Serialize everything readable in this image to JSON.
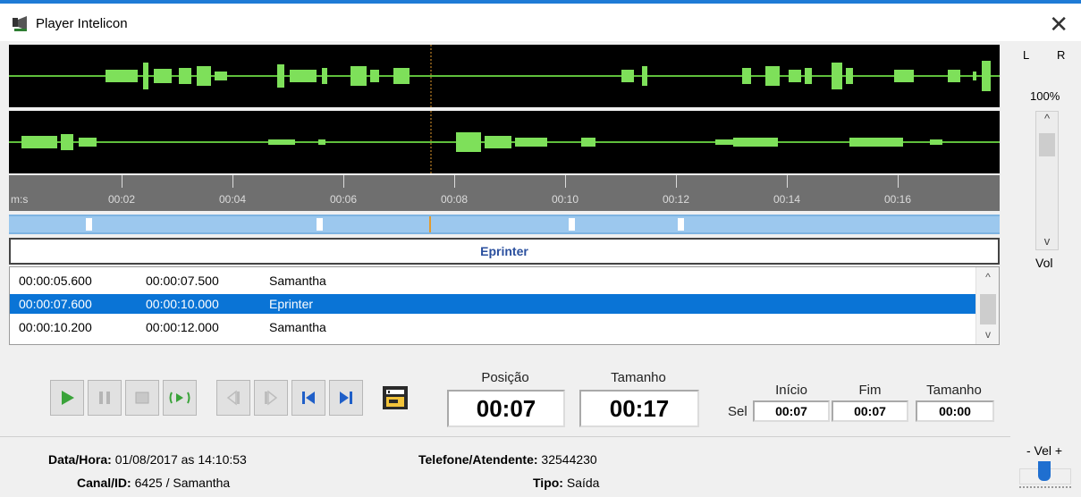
{
  "window": {
    "title": "Player Intelicon",
    "close_icon": "close-icon"
  },
  "timeline": {
    "unit": "m:s",
    "ticks": [
      "00:02",
      "00:04",
      "00:06",
      "00:08",
      "00:10",
      "00:12",
      "00:14",
      "00:16"
    ]
  },
  "segment_title": "Eprinter",
  "segments": [
    {
      "start": "00:00:05.600",
      "end": "00:00:07.500",
      "speaker": "Samantha",
      "selected": false
    },
    {
      "start": "00:00:07.600",
      "end": "00:00:10.000",
      "speaker": "Eprinter",
      "selected": true
    },
    {
      "start": "00:00:10.200",
      "end": "00:00:12.000",
      "speaker": "Samantha",
      "selected": false
    }
  ],
  "transport": {
    "buttons": [
      "play-icon",
      "pause-icon",
      "stop-icon",
      "loop-play-icon",
      "step-back-icon",
      "step-forward-icon",
      "skip-start-icon",
      "skip-end-icon",
      "export-icon"
    ]
  },
  "position": {
    "label": "Posição",
    "value": "00:07"
  },
  "length": {
    "label": "Tamanho",
    "value": "00:17"
  },
  "selection": {
    "prefix": "Sel",
    "start_label": "Início",
    "start_value": "00:07",
    "end_label": "Fim",
    "end_value": "00:07",
    "size_label": "Tamanho",
    "size_value": "00:00"
  },
  "volume": {
    "left_label": "L",
    "right_label": "R",
    "percent": "100%",
    "label": "Vol"
  },
  "speed": {
    "label": "- Vel +"
  },
  "info": {
    "datetime_label": "Data/Hora:",
    "datetime_value": "01/08/2017 as 14:10:53",
    "channel_label": "Canal/ID:",
    "channel_value": "6425 / Samantha",
    "phone_label": "Telefone/Atendente:",
    "phone_value": "32544230",
    "type_label": "Tipo:",
    "type_value": "Saída"
  },
  "colors": {
    "accent": "#0a74d6",
    "wave": "#7ee05a",
    "segment_bar": "#9cc8ee"
  }
}
